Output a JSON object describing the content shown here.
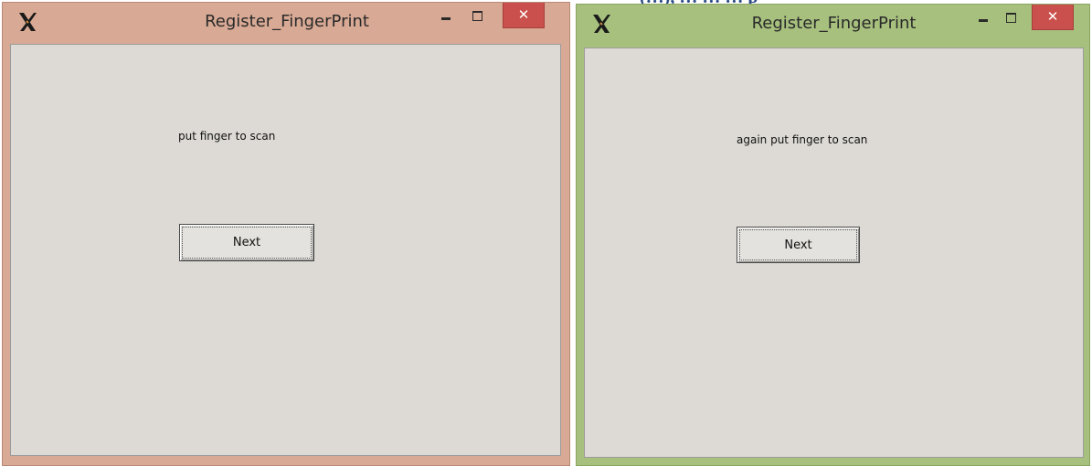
{
  "caption_fragment": "(…), … … … p",
  "windows": [
    {
      "title": "Register_FingerPrint",
      "prompt": "put finger to scan",
      "button_label": "Next",
      "close_glyph": "✕",
      "frame_color": "#d8a994",
      "close_color": "#c9504c"
    },
    {
      "title": "Register_FingerPrint",
      "prompt": "again put finger to scan",
      "button_label": "Next",
      "close_glyph": "✕",
      "frame_color": "#a7c07e",
      "close_color": "#c9504c"
    }
  ],
  "icons": {
    "app": "x11-x-icon",
    "minimize": "minimize-icon",
    "maximize": "maximize-icon",
    "close": "close-icon"
  }
}
